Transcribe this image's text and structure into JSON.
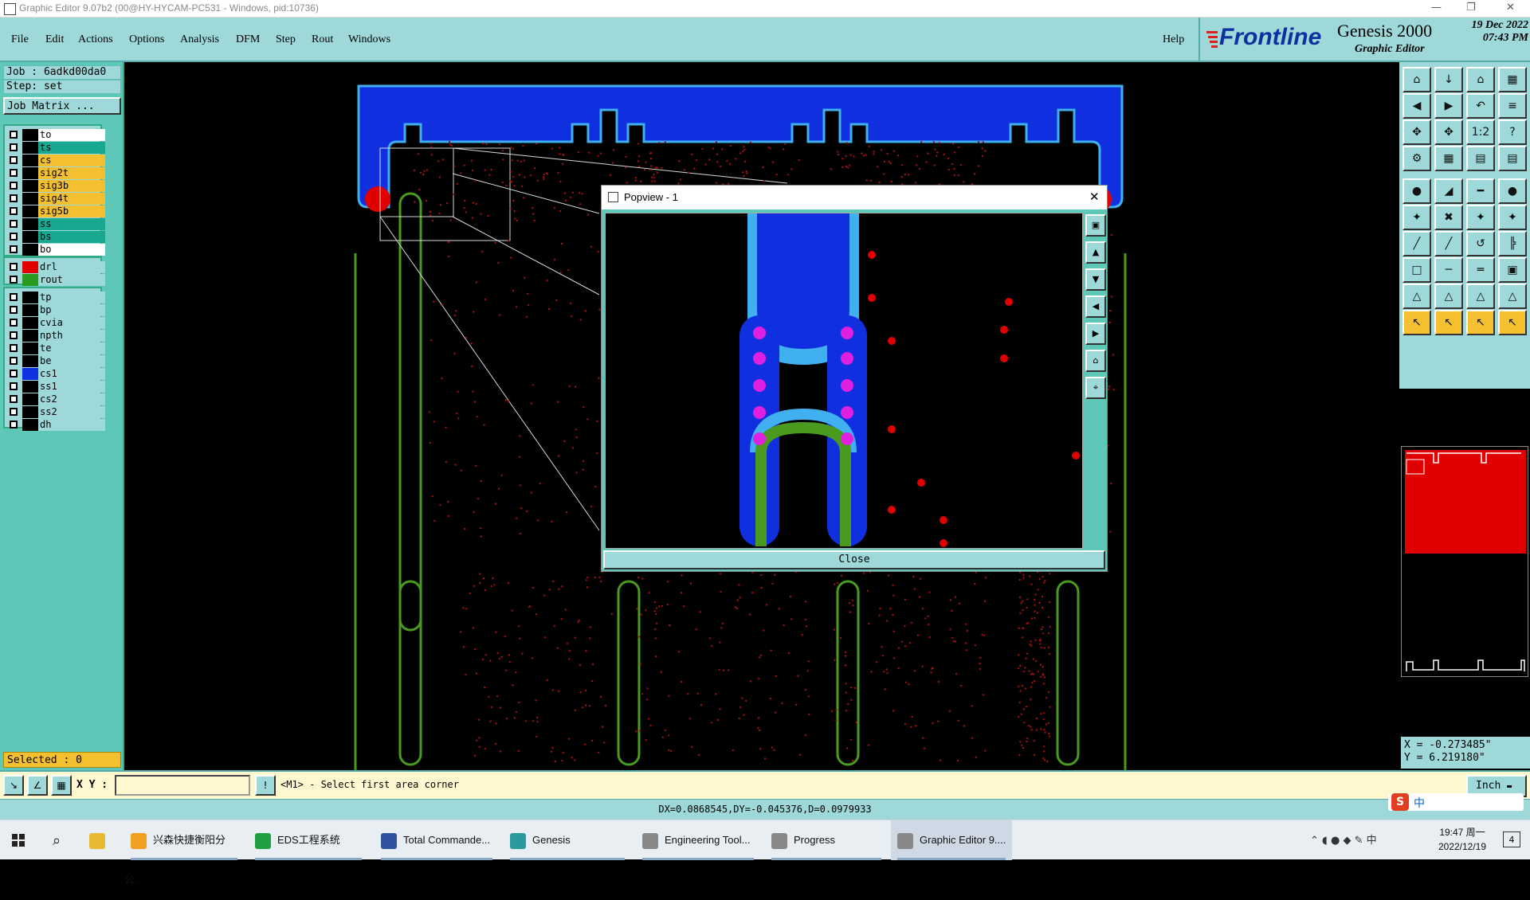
{
  "window": {
    "title": "Graphic Editor 9.07b2 (00@HY-HYCAM-PC531 - Windows, pid:10736)",
    "min": "—",
    "max": "❐",
    "close": "✕"
  },
  "menu": {
    "items": [
      "File",
      "Edit",
      "Actions",
      "Options",
      "Analysis",
      "DFM",
      "Step",
      "Rout",
      "Windows"
    ],
    "help": "Help"
  },
  "brand": {
    "logo": "Frontline",
    "product": "Genesis 2000",
    "subtitle": "Graphic Editor",
    "date": "19 Dec 2022",
    "time": "07:43 PM"
  },
  "job": {
    "job_line": "Job : 6adkd00da0",
    "step_line": "Step: set",
    "matrix_button": "Job Matrix ..."
  },
  "layers_group1": [
    {
      "name": "to",
      "color": "#ffffff",
      "swatch": "#000000"
    },
    {
      "name": "ts",
      "color": "#18a890",
      "swatch": "#000000"
    },
    {
      "name": "cs",
      "color": "#f5c030",
      "swatch": "#000000"
    },
    {
      "name": "sig2t",
      "color": "#f5c030",
      "swatch": "#000000"
    },
    {
      "name": "sig3b",
      "color": "#f5c030",
      "swatch": "#000000"
    },
    {
      "name": "sig4t",
      "color": "#f5c030",
      "swatch": "#000000"
    },
    {
      "name": "sig5b",
      "color": "#f5c030",
      "swatch": "#000000"
    },
    {
      "name": "ss",
      "color": "#18a890",
      "swatch": "#000000"
    },
    {
      "name": "bs",
      "color": "#18a890",
      "swatch": "#000000"
    },
    {
      "name": "bo",
      "color": "#ffffff",
      "swatch": "#000000"
    }
  ],
  "layers_group2": [
    {
      "name": "drl",
      "color": "#9ed8d8",
      "swatch": "#e00000"
    },
    {
      "name": "rout",
      "color": "#9ed8d8",
      "swatch": "#2a9a20"
    }
  ],
  "layers_group3": [
    {
      "name": "tp",
      "color": "#9ed8d8",
      "swatch": "#000000"
    },
    {
      "name": "bp",
      "color": "#9ed8d8",
      "swatch": "#000000"
    },
    {
      "name": "cvia",
      "color": "#9ed8d8",
      "swatch": "#000000"
    },
    {
      "name": "npth",
      "color": "#9ed8d8",
      "swatch": "#000000"
    },
    {
      "name": "te",
      "color": "#9ed8d8",
      "swatch": "#000000"
    },
    {
      "name": "be",
      "color": "#9ed8d8",
      "swatch": "#000000"
    },
    {
      "name": "cs1",
      "color": "#9ed8d8",
      "swatch": "#1030e0"
    },
    {
      "name": "ss1",
      "color": "#9ed8d8",
      "swatch": "#000000"
    },
    {
      "name": "cs2",
      "color": "#9ed8d8",
      "swatch": "#000000"
    },
    {
      "name": "ss2",
      "color": "#9ed8d8",
      "swatch": "#000000"
    },
    {
      "name": "dh",
      "color": "#9ed8d8",
      "swatch": "#000000"
    }
  ],
  "status": {
    "selected": "Selected : 0",
    "xy_label": "X Y :",
    "xy_value": "",
    "prompt": "<M1> - Select first area corner",
    "unit": "Inch",
    "dx_line": "DX=0.0868545,DY=-0.045376,D=0.0979933"
  },
  "coords": {
    "x": "X = -0.273485\"",
    "y": "Y = 6.219180\""
  },
  "popview": {
    "title": "Popview - 1",
    "close_label": "Close"
  },
  "taskbar": {
    "items": [
      {
        "label": "兴森快捷衡阳分公...",
        "color": "#f0a020"
      },
      {
        "label": "EDS工程系统",
        "color": "#1f9f3f"
      },
      {
        "label": "Total Commande...",
        "color": "#3050a0"
      },
      {
        "label": "Genesis",
        "color": "#2a9aa0"
      },
      {
        "label": "Engineering Tool...",
        "color": "#888888"
      },
      {
        "label": "Progress",
        "color": "#888888"
      },
      {
        "label": "Graphic Editor 9....",
        "color": "#888888"
      }
    ],
    "clock_time": "19:47 周一",
    "clock_date": "2022/12/19",
    "ime": "中",
    "notif_count": "4"
  },
  "colors": {
    "panel": "#9ed8d8",
    "panel_dark": "#5ec8b8",
    "copper_blue": "#1030e0",
    "light_blue": "#40b0f0",
    "rout_green": "#4a9a20",
    "drill_red": "#e00000",
    "pad_magenta": "#e020e0"
  }
}
